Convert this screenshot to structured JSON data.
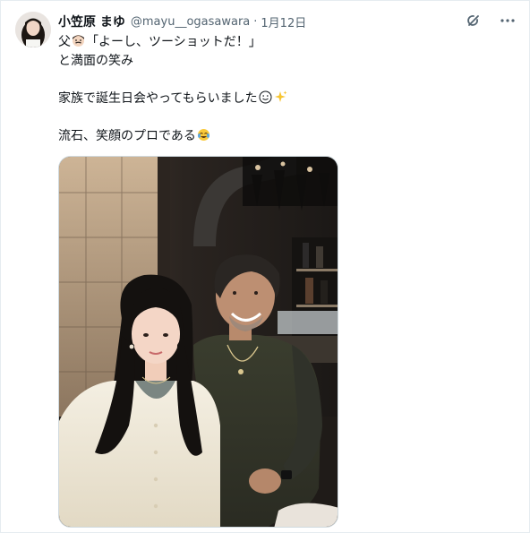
{
  "tweet": {
    "display_name": "小笠原 まゆ",
    "handle": "@mayu__ogasawara",
    "separator": "·",
    "date": "1月12日",
    "lines": [
      {
        "pre": "父",
        "post": "「よーし、ツーショットだ！」"
      },
      {
        "text": "と満面の笑み"
      },
      {
        "text": "家族で誕生日会やってもらいました"
      },
      {
        "text": "流石、笑顔のプロである"
      }
    ]
  },
  "icons": {
    "avatar": "profile-photo",
    "grok": "grok-icon",
    "more": "more-icon",
    "emoji_dad": "man-with-mustache-emoji",
    "emoji_smile": "smiling-face-emoji",
    "emoji_sparkles": "sparkles-emoji",
    "emoji_tears": "face-with-tears-of-joy-emoji"
  },
  "colors": {
    "text": "#0f1419",
    "secondary": "#536471",
    "border": "#cfd9de"
  }
}
